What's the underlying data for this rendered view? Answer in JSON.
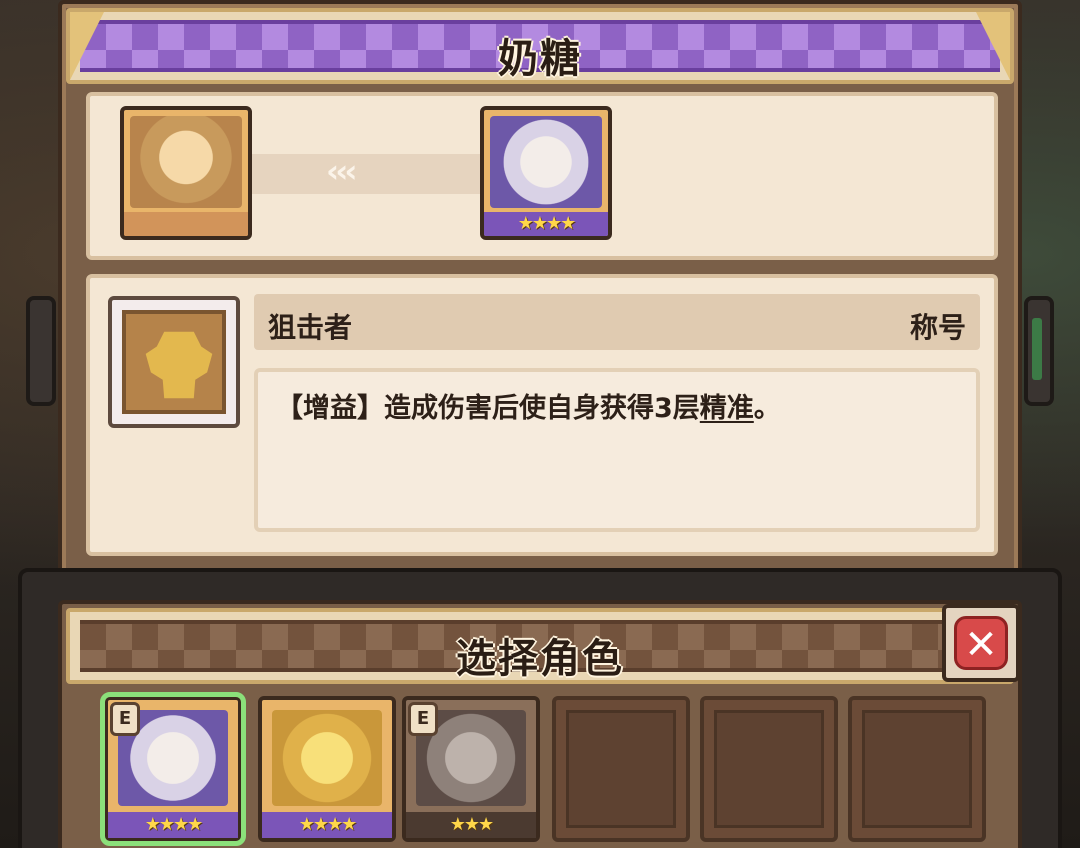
{
  "character": {
    "name": "奶糖",
    "from_portrait": {
      "desc": "blonde-haired girl",
      "bg": "#b8844c",
      "strip": "#d2945a"
    },
    "to_portrait": {
      "desc": "white-haired girl",
      "bg": "#6d58a8",
      "strip": "#7b55b8",
      "stars": "★★★★"
    },
    "arrows": "‹‹‹"
  },
  "skill": {
    "name": "狙击者",
    "type": "称号",
    "desc_prefix": "【增益】造成伤害后使自身获得3层",
    "desc_keyword": "精准",
    "desc_suffix": "。",
    "icon": "golden-bear-icon"
  },
  "select": {
    "title": "选择角色",
    "close_label": "✕",
    "slots": [
      {
        "badge": "E",
        "stars": "★★★★",
        "face": "#6d58a8",
        "strip": "#7b55b8",
        "selected": true
      },
      {
        "badge": "",
        "stars": "★★★★",
        "face": "#c9973a",
        "strip": "#7b55b8",
        "selected": false
      },
      {
        "badge": "E",
        "stars": "★★★",
        "face": "#5c4c46",
        "strip": "#4b3a30",
        "selected": false
      }
    ]
  },
  "colors": {
    "purple_ribbon": "#8f63c4",
    "panel_bg": "#7a5f48",
    "close_red": "#d84a4a",
    "selected_outline": "#8be07a"
  }
}
